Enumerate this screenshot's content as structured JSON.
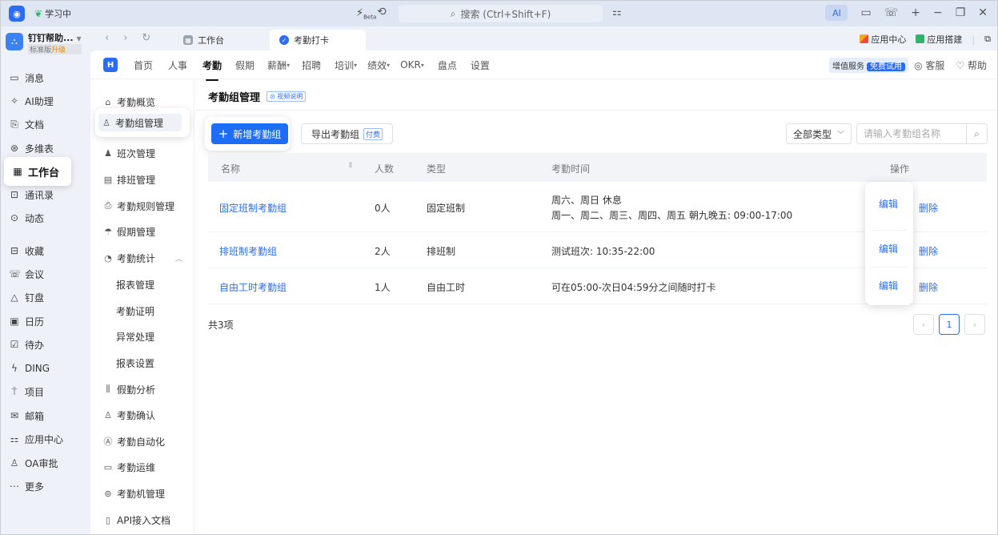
{
  "titlebar": {
    "study_label": "学习中",
    "search_text": "搜索 (Ctrl+Shift+F)",
    "ai_label": "AI"
  },
  "org": {
    "name": "钉钉帮助...",
    "tier": "标准版",
    "upgrade": "升级"
  },
  "leftnav": {
    "items": [
      {
        "label": "消息",
        "icon": "message-icon"
      },
      {
        "label": "AI助理",
        "icon": "ai-assistant-icon"
      },
      {
        "label": "文档",
        "icon": "document-icon"
      },
      {
        "label": "多维表",
        "icon": "multi-table-icon"
      },
      {
        "label": "工作台",
        "icon": "workbench-icon"
      },
      {
        "label": "通讯录",
        "icon": "contacts-icon"
      },
      {
        "label": "动态",
        "icon": "activity-icon"
      },
      {
        "label": "收藏",
        "icon": "favorites-icon"
      },
      {
        "label": "会议",
        "icon": "meeting-icon"
      },
      {
        "label": "钉盘",
        "icon": "drive-icon"
      },
      {
        "label": "日历",
        "icon": "calendar-icon"
      },
      {
        "label": "待办",
        "icon": "todo-icon"
      },
      {
        "label": "DING",
        "icon": "ding-icon"
      },
      {
        "label": "项目",
        "icon": "project-icon"
      },
      {
        "label": "邮箱",
        "icon": "mail-icon"
      },
      {
        "label": "应用中心",
        "icon": "app-center-icon"
      },
      {
        "label": "OA审批",
        "icon": "approval-icon"
      },
      {
        "label": "更多",
        "icon": "more-icon"
      }
    ]
  },
  "tabs": {
    "items": [
      {
        "label": "工作台"
      },
      {
        "label": "考勤打卡"
      }
    ],
    "app_center": "应用中心",
    "app_builder": "应用搭建"
  },
  "topmenu": {
    "items": [
      "首页",
      "人事",
      "考勤",
      "假期",
      "薪酬",
      "招聘",
      "培训",
      "绩效",
      "OKR",
      "盘点",
      "设置"
    ],
    "service": "增值服务",
    "free_trial": "免费试用",
    "customer_service": "客服",
    "help": "帮助"
  },
  "subnav": {
    "overview": "考勤概览",
    "group_mgmt": "考勤组管理",
    "shift_mgmt": "班次管理",
    "schedule_mgmt": "排班管理",
    "rule_mgmt": "考勤规则管理",
    "leave_mgmt": "假期管理",
    "stats": "考勤统计",
    "report_mgmt": "报表管理",
    "proof": "考勤证明",
    "exception": "异常处理",
    "report_settings": "报表设置",
    "leave_analysis": "假勤分析",
    "confirm": "考勤确认",
    "automation": "考勤自动化",
    "ops": "考勤运维",
    "machine": "考勤机管理",
    "api": "API接入文档"
  },
  "panel": {
    "title": "考勤组管理",
    "video_badge": "视频说明",
    "add_button": "新增考勤组",
    "export_button": "导出考勤组",
    "paid_badge": "付费",
    "type_select": "全部类型",
    "search_placeholder": "请输入考勤组名称",
    "columns": {
      "name": "名称",
      "count": "人数",
      "type": "类型",
      "time": "考勤时间",
      "ops": "操作"
    },
    "rows": [
      {
        "name": "固定班制考勤组",
        "count": "0人",
        "type": "固定班制",
        "time1": "周六、周日  休息",
        "time2": "周一、周二、周三、周四、周五  朝九晚五: 09:00-17:00"
      },
      {
        "name": "排班制考勤组",
        "count": "2人",
        "type": "排班制",
        "time1": "测试班次: 10:35-22:00",
        "time2": ""
      },
      {
        "name": "自由工时考勤组",
        "count": "1人",
        "type": "自由工时",
        "time1": "可在05:00-次日04:59分之间随时打卡",
        "time2": ""
      }
    ],
    "edit": "编辑",
    "delete": "删除",
    "total": "共3项",
    "page": "1"
  }
}
